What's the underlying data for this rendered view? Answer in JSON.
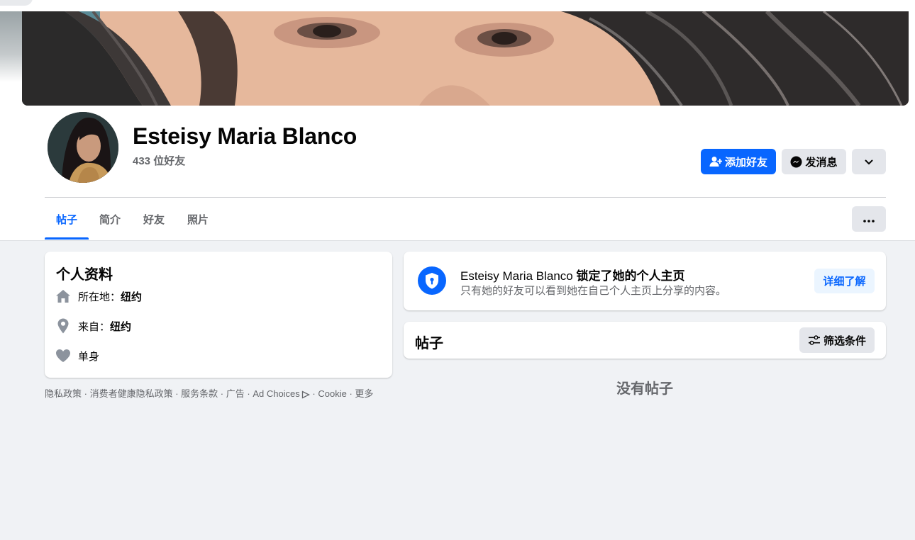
{
  "profile": {
    "name": "Esteisy Maria Blanco",
    "friends_count": "433 位好友"
  },
  "actions": {
    "add_friend": "添加好友",
    "message": "发消息"
  },
  "tabs": [
    {
      "label": "帖子",
      "active": true
    },
    {
      "label": "简介",
      "active": false
    },
    {
      "label": "好友",
      "active": false
    },
    {
      "label": "照片",
      "active": false
    }
  ],
  "intro": {
    "title": "个人资料",
    "items": [
      {
        "icon": "home-icon",
        "label": "所在地：",
        "value": "纽约"
      },
      {
        "icon": "location-pin-icon",
        "label": "来自：",
        "value": "纽约"
      },
      {
        "icon": "heart-icon",
        "label": "单身",
        "value": ""
      }
    ]
  },
  "footer": {
    "links": [
      "隐私政策",
      "消费者健康隐私政策",
      "服务条款",
      "广告",
      "Ad Choices",
      "Cookie",
      "更多"
    ]
  },
  "locked_notice": {
    "name": "Esteisy Maria Blanco",
    "title_suffix": "锁定了她的个人主页",
    "subtitle": "只有她的好友可以看到她在自己个人主页上分享的内容。",
    "learn_more": "详细了解"
  },
  "posts": {
    "title": "帖子",
    "filter_label": "筛选条件",
    "empty_text": "没有帖子"
  },
  "colors": {
    "primary": "#0866ff",
    "background": "#f0f2f5",
    "secondary_button": "#e4e6eb",
    "muted_text": "#65676b"
  }
}
